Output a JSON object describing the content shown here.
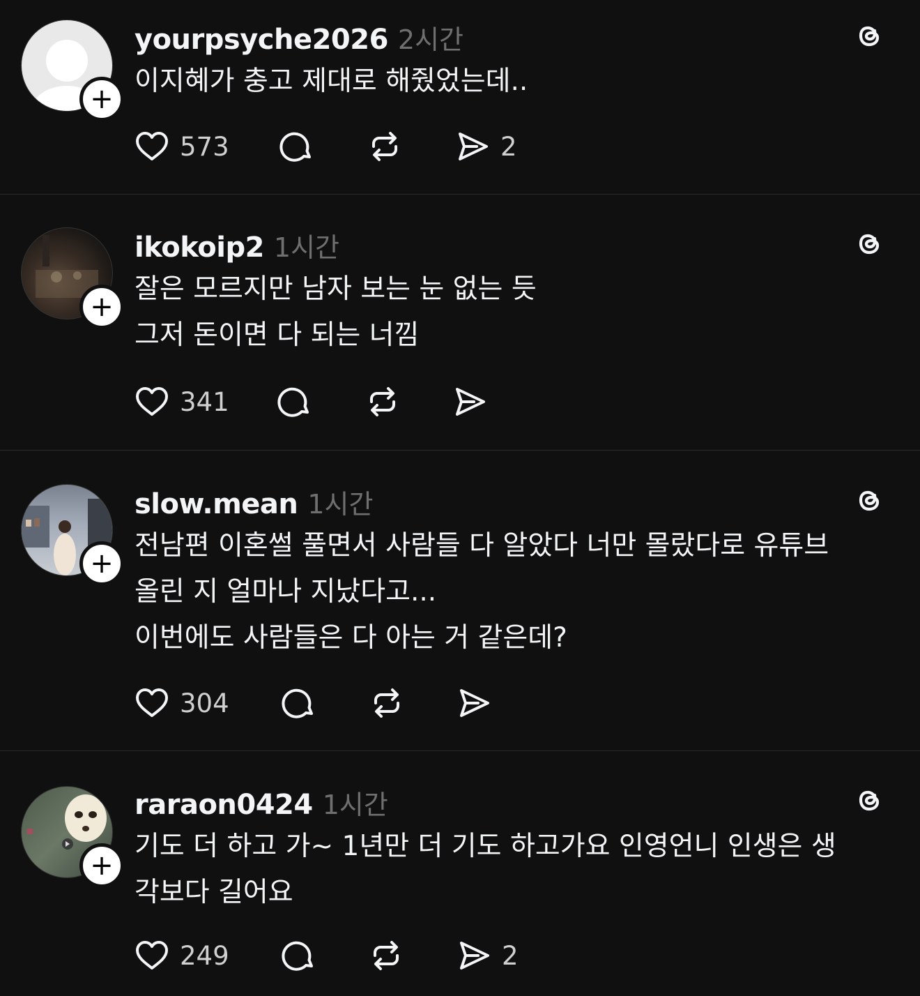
{
  "posts": [
    {
      "username": "yourpsyche2026",
      "time": "2시간",
      "avatar": "default-avatar",
      "lines": [
        "이지혜가 충고 제대로 해줬었는데.."
      ],
      "likes": "573",
      "reposts": "",
      "shares": "2"
    },
    {
      "username": "ikokoip2",
      "time": "1시간",
      "avatar": "photo-avatar",
      "lines": [
        "잘은 모르지만 남자 보는 눈 없는 듯",
        "그저 돈이면 다 되는 너낌"
      ],
      "likes": "341",
      "reposts": "",
      "shares": ""
    },
    {
      "username": "slow.mean",
      "time": "1시간",
      "avatar": "photo-avatar",
      "lines": [
        "전남편 이혼썰 풀면서 사람들 다 알았다 너만 몰랐다로 유튜브",
        "올린 지 얼마나 지났다고...",
        "이번에도 사람들은 다 아는 거 같은데?"
      ],
      "likes": "304",
      "reposts": "",
      "shares": ""
    },
    {
      "username": "raraon0424",
      "time": "1시간",
      "avatar": "photo-avatar",
      "lines": [
        "기도 더 하고 가~ 1년만 더 기도 하고가요 인영언니 인생은 생",
        "각보다 길어요"
      ],
      "likes": "249",
      "reposts": "",
      "shares": "2"
    }
  ],
  "follow_symbol": "+",
  "icons": {
    "like": "heart-icon",
    "reply": "comment-icon",
    "repost": "repost-icon",
    "share": "send-icon",
    "app": "threads-icon"
  }
}
